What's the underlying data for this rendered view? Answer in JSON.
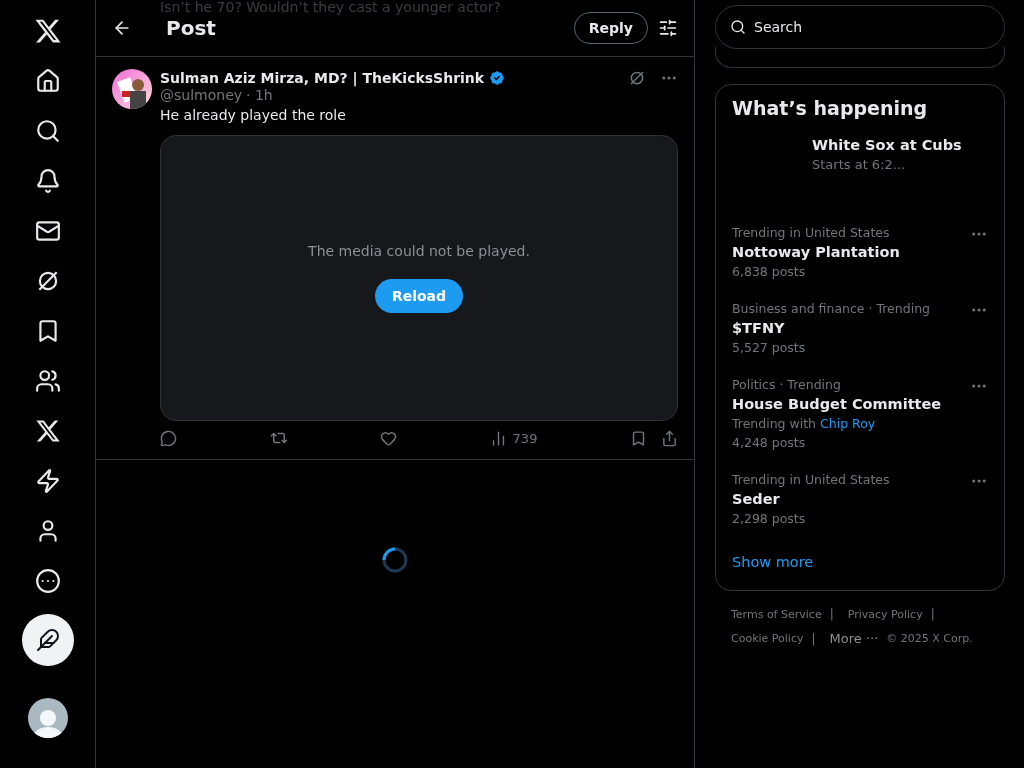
{
  "previous_post_text": "Isn’t he 70? Wouldn’t they cast a younger actor?",
  "header": {
    "title": "Post",
    "reply_button": "Reply"
  },
  "post": {
    "author": "Sulman Aziz Mirza, MD? | TheKicksShrink",
    "verified": true,
    "handle": "@sulmoney",
    "time": "· 1h",
    "text": "He already played the role",
    "media_error": "The media could not be played.",
    "reload_button": "Reload",
    "views": "739"
  },
  "search": {
    "placeholder": "Search"
  },
  "trends": {
    "title": "What’s happening",
    "event": {
      "title": "White Sox at Cubs",
      "subtitle": "Starts at 6:2..."
    },
    "items": [
      {
        "context": "Trending in United States",
        "title": "Nottoway Plantation",
        "posts": "6,838 posts"
      },
      {
        "context": "Business and finance · Trending",
        "title": "$TFNY",
        "posts": "5,527 posts"
      },
      {
        "context": "Politics · Trending",
        "title": "House Budget Committee",
        "trending_with": "Trending with",
        "link": "Chip Roy",
        "posts": "4,248 posts"
      },
      {
        "context": "Trending in United States",
        "title": "Seder",
        "posts": "2,298 posts"
      }
    ],
    "show_more": "Show more"
  },
  "footer": {
    "links": [
      "Terms of Service",
      "Privacy Policy",
      "Cookie Policy"
    ],
    "separator": "|",
    "more": "More",
    "more_dots": "···",
    "copyright": "© 2025 X Corp."
  }
}
